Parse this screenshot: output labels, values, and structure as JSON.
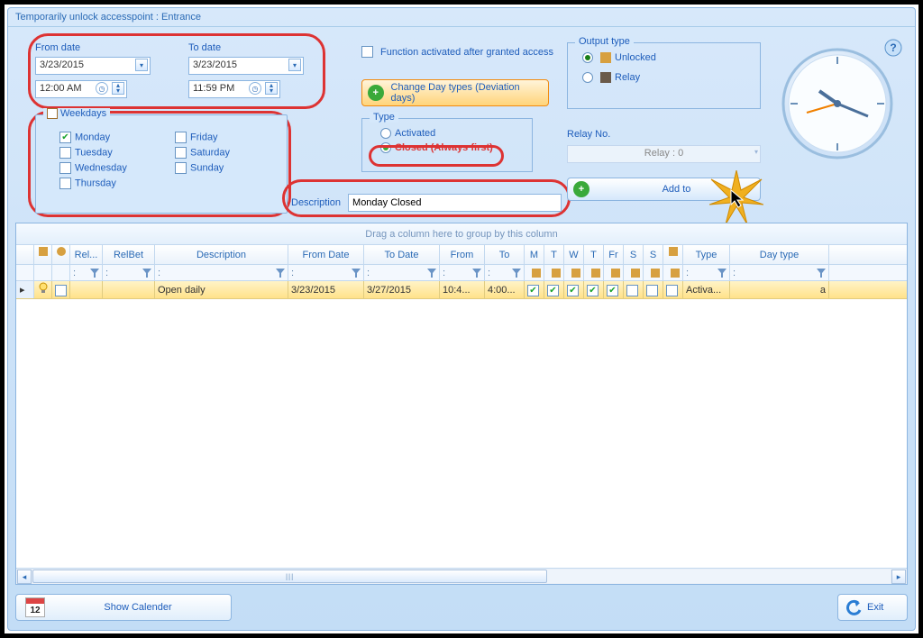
{
  "window_title": "Temporarily unlock accesspoint : Entrance",
  "dates": {
    "from_label": "From date",
    "to_label": "To date",
    "from_date": "3/23/2015",
    "to_date": "3/23/2015",
    "from_time": "12:00 AM",
    "to_time": "11:59 PM"
  },
  "weekdays": {
    "legend": "Weekdays",
    "monday": "Monday",
    "tuesday": "Tuesday",
    "wednesday": "Wednesday",
    "thursday": "Thursday",
    "friday": "Friday",
    "saturday": "Saturday",
    "sunday": "Sunday",
    "checked": {
      "monday": true,
      "tuesday": false,
      "wednesday": false,
      "thursday": false,
      "friday": false,
      "saturday": false,
      "sunday": false
    }
  },
  "func_after_access": "Function activated after granted access",
  "change_days_btn": "Change Day types (Deviation days)",
  "type": {
    "legend": "Type",
    "activated": "Activated",
    "closed": "Closed (Always first)",
    "selected": "closed"
  },
  "description_label": "Description",
  "description_value": "Monday Closed",
  "output": {
    "legend": "Output type",
    "unlocked": "Unlocked",
    "relay": "Relay",
    "selected": "unlocked"
  },
  "relay_label": "Relay No.",
  "relay_value": "Relay : 0",
  "add_button": "Add to",
  "group_header": "Drag a column here to group by this column",
  "columns": {
    "rel": "Rel...",
    "relbet": "RelBet",
    "desc": "Description",
    "from_date": "From Date",
    "to_date": "To Date",
    "from": "From",
    "to": "To",
    "m": "M",
    "t1": "T",
    "w": "W",
    "t2": "T",
    "fr": "Fr",
    "s1": "S",
    "s2": "S",
    "type": "Type",
    "daytype": "Day type"
  },
  "row": {
    "desc": "Open daily",
    "from_date": "3/23/2015",
    "to_date": "3/27/2015",
    "from": "10:4...",
    "to": "4:00...",
    "m": true,
    "t1": true,
    "w": true,
    "t2": true,
    "fr": true,
    "s1": false,
    "s2": false,
    "type": "Activa...",
    "daytype_suffix": "a"
  },
  "show_calendar": "Show Calender",
  "calendar_day": "12",
  "exit": "Exit"
}
